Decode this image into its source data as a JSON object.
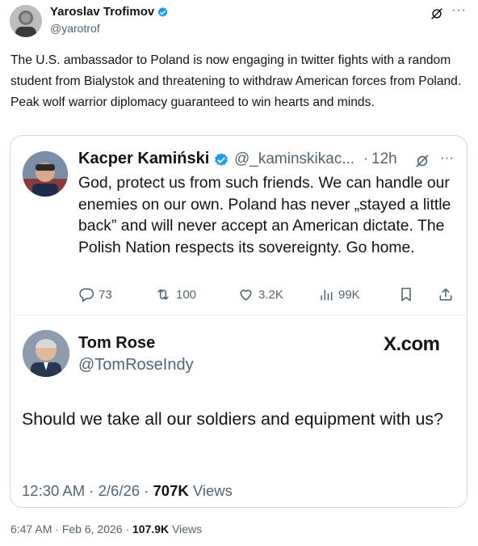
{
  "outer_tweet": {
    "author_name": "Yaroslav Trofimov",
    "handle": "@yarotrof",
    "text": "The U.S. ambassador to Poland is now engaging in twitter fights with a random student from Bialystok and threatening to withdraw American forces from Poland. Peak wolf warrior diplomacy guaranteed to win hearts and minds.",
    "time": "6:47 AM",
    "date": "Feb 6, 2026",
    "views_count": "107.9K",
    "views_label": "Views"
  },
  "quoted_tweet": {
    "author_name": "Kacper Kamiński",
    "handle": "@_kaminskikac...",
    "time": "12h",
    "text": "God, protect us from such friends. We can handle our enemies on our own. Poland has never „stayed a little back” and will never accept an American dictate. The Polish Nation respects its sovereignty. Go home.",
    "stats": {
      "replies": "73",
      "retweets": "100",
      "likes": "3.2K",
      "views": "99K"
    }
  },
  "screenshot_tweet": {
    "author_name": "Tom Rose",
    "handle": "@TomRoseIndy",
    "brand": "X.com",
    "text": "Should we take all our soldiers and equipment with us?",
    "time": "12:30 AM",
    "date": "2/6/26",
    "views_count": "707K",
    "views_label": "Views"
  },
  "icons": [
    "verified-badge-icon",
    "grok-icon",
    "more-icon",
    "reply-icon",
    "retweet-icon",
    "like-icon",
    "views-icon",
    "bookmark-icon",
    "share-icon"
  ],
  "colors": {
    "verified": "#1d9bf0",
    "text": "#0f1419",
    "secondary": "#536471",
    "border": "#cfd9de"
  }
}
